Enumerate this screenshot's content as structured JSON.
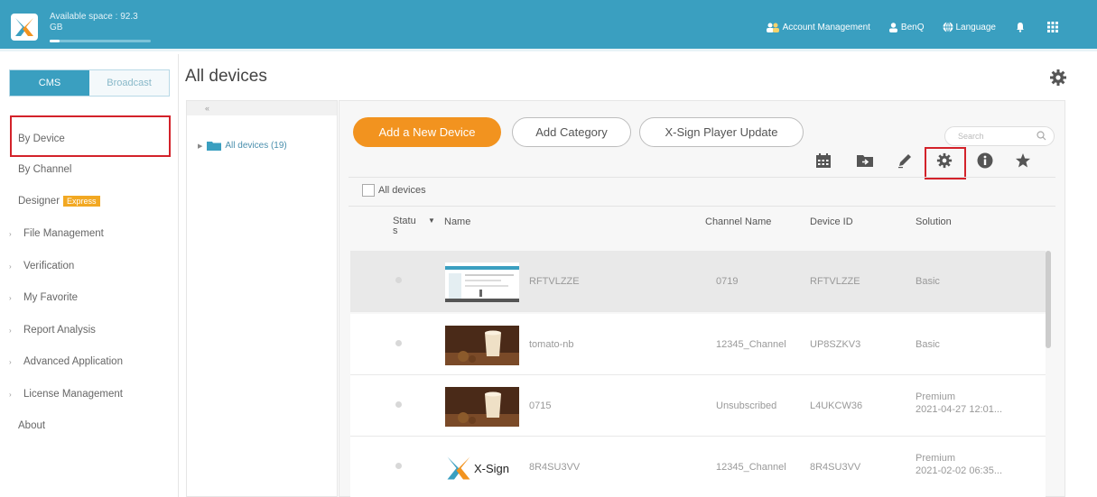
{
  "header": {
    "space_line1": "Available space : 92.3",
    "space_line2": "GB",
    "space_used_fraction": 0.1,
    "account_management": "Account Management",
    "user": "BenQ",
    "language": "Language"
  },
  "sidebar": {
    "tab_cms": "CMS",
    "tab_broadcast": "Broadcast",
    "items": [
      {
        "label": "By Device",
        "arrow": false
      },
      {
        "label": "By Channel",
        "arrow": false
      },
      {
        "label": "Designer",
        "arrow": false,
        "badge": "Express"
      },
      {
        "label": "File Management",
        "arrow": true
      },
      {
        "label": "Verification",
        "arrow": true
      },
      {
        "label": "My Favorite",
        "arrow": true
      },
      {
        "label": "Report Analysis",
        "arrow": true
      },
      {
        "label": "Advanced Application",
        "arrow": true
      },
      {
        "label": "License Management",
        "arrow": true
      },
      {
        "label": "About",
        "arrow": false
      }
    ]
  },
  "page": {
    "title": "All devices"
  },
  "tree": {
    "collapse": "«",
    "node_label": "All devices (19)"
  },
  "toolbar": {
    "add_device": "Add a New Device",
    "add_category": "Add Category",
    "player_update": "X-Sign Player Update",
    "search_placeholder": "Search",
    "icons": [
      "calendar-icon",
      "folder-icon",
      "edit-icon",
      "gear-icon",
      "info-icon",
      "star-icon"
    ]
  },
  "table": {
    "select_all_label": "All devices",
    "headers": {
      "status": "Statu s",
      "name": "Name",
      "channel": "Channel Name",
      "device_id": "Device ID",
      "solution": "Solution"
    },
    "rows": [
      {
        "name": "RFTVLZZE",
        "channel": "0719",
        "device_id": "RFTVLZZE",
        "solution": "Basic",
        "solution2": "",
        "thumb": "screenshot"
      },
      {
        "name": "tomato-nb",
        "channel": "12345_Channel",
        "device_id": "UP8SZKV3",
        "solution": "Basic",
        "solution2": "",
        "thumb": "drink"
      },
      {
        "name": "0715",
        "channel": "Unsubscribed",
        "device_id": "L4UKCW36",
        "solution": "Premium",
        "solution2": "2021-04-27 12:01...",
        "thumb": "drink"
      },
      {
        "name": "8R4SU3VV",
        "channel": "12345_Channel",
        "device_id": "8R4SU3VV",
        "solution": "Premium",
        "solution2": "2021-02-02 06:35...",
        "thumb": "xsign"
      }
    ],
    "thumb_logo_text": "X-Sign"
  },
  "colors": {
    "brand": "#3a9fc0",
    "accent_orange": "#f2931f",
    "highlight_red": "#d3222a"
  }
}
